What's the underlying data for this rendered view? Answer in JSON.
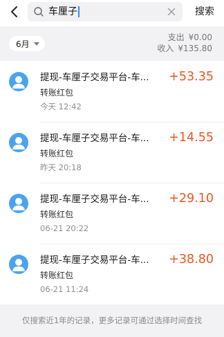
{
  "search": {
    "query": "车厘子",
    "button_label": "搜索"
  },
  "summary": {
    "month_label": "6月",
    "expense_label": "支出",
    "expense_value": "¥0.00",
    "income_label": "收入",
    "income_value": "¥135.80"
  },
  "transactions": [
    {
      "title": "提现-车厘子交易平台-车...",
      "type": "转账红包",
      "time": "今天  12:42",
      "amount": "+53.35"
    },
    {
      "title": "提现-车厘子交易平台-车...",
      "type": "转账红包",
      "time": "昨天  20:18",
      "amount": "+14.55"
    },
    {
      "title": "提现-车厘子交易平台-车...",
      "type": "转账红包",
      "time": "06-21  20:22",
      "amount": "+29.10"
    },
    {
      "title": "提现-车厘子交易平台-车...",
      "type": "转账红包",
      "time": "06-21  11:24",
      "amount": "+38.80"
    }
  ],
  "footer": {
    "note": "仅搜索近1年的记录，更多记录可通过选择时间查找"
  },
  "colors": {
    "amount": "#f05522",
    "avatar": "#4aa3ef",
    "caret": "#2f8cff"
  },
  "icons": [
    "back-arrow-icon",
    "search-icon",
    "clear-icon",
    "user-avatar-icon",
    "chevron-down-icon"
  ]
}
